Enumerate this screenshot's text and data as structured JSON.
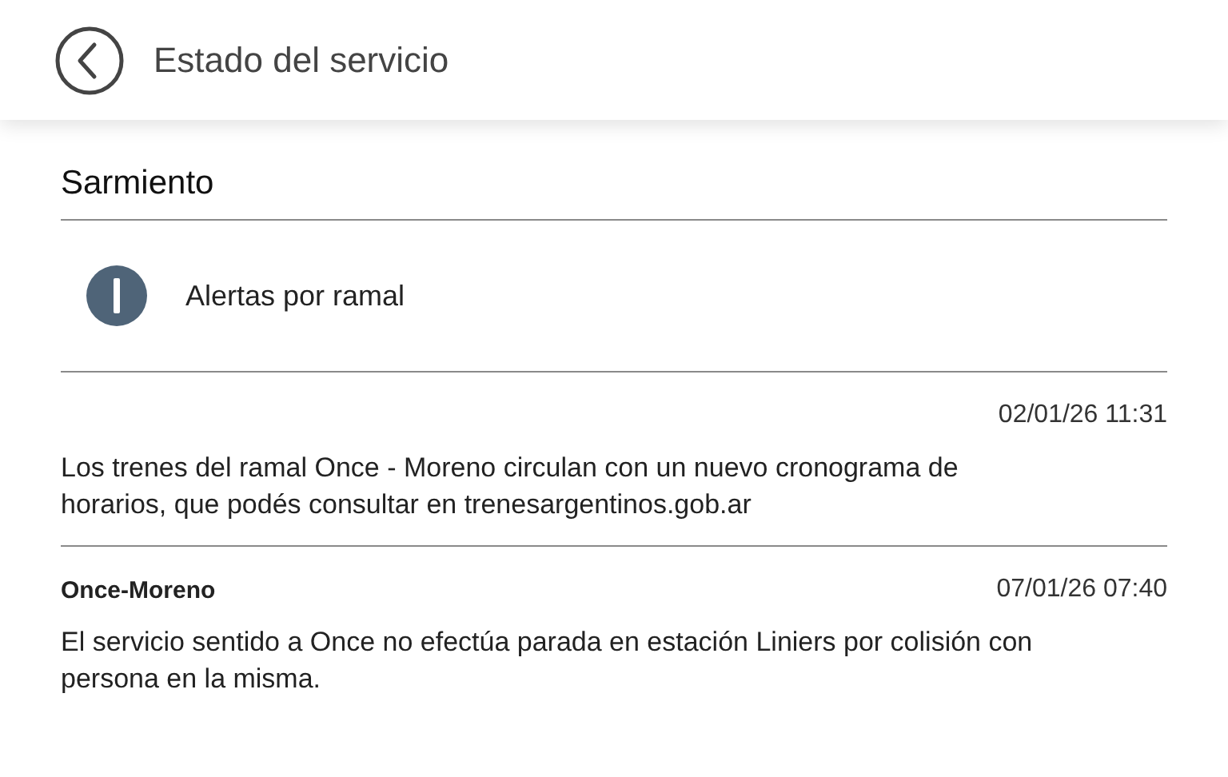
{
  "header": {
    "title": "Estado del servicio"
  },
  "line": {
    "name": "Sarmiento"
  },
  "section": {
    "label": "Alertas por ramal"
  },
  "alerts": [
    {
      "date": "02/01/26 11:31",
      "text": "Los trenes del ramal Once - Moreno circulan con un nuevo cronograma de horarios, que podés consultar en trenesargentinos.gob.ar"
    },
    {
      "branch": "Once-Moreno",
      "date": "07/01/26 07:40",
      "text": "El servicio sentido a Once no efectúa parada en estación Liniers por colisión con persona en la misma."
    }
  ]
}
